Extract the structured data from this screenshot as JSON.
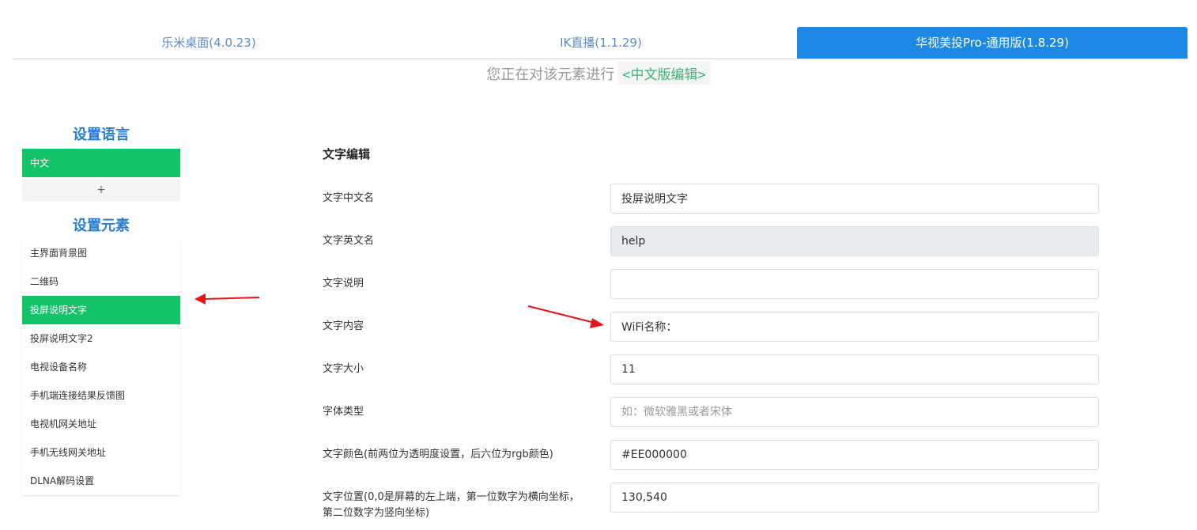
{
  "tabs": [
    {
      "label": "乐米桌面(4.0.23)",
      "active": false
    },
    {
      "label": "IK直播(1.1.29)",
      "active": false
    },
    {
      "label": "华视美投Pro-通用版(1.8.29)",
      "active": true
    }
  ],
  "editing": {
    "prefix": "您正在对该元素进行",
    "mode": "<中文版编辑>"
  },
  "sidebar": {
    "language_title": "设置语言",
    "languages": [
      {
        "label": "中文",
        "active": true
      }
    ],
    "add_label": "+",
    "element_title": "设置元素",
    "elements": [
      {
        "label": "主界面背景图",
        "active": false
      },
      {
        "label": "二维码",
        "active": false
      },
      {
        "label": "投屏说明文字",
        "active": true
      },
      {
        "label": "投屏说明文字2",
        "active": false
      },
      {
        "label": "电视设备名称",
        "active": false
      },
      {
        "label": "手机端连接结果反馈图",
        "active": false
      },
      {
        "label": "电视机网关地址",
        "active": false
      },
      {
        "label": "手机无线网关地址",
        "active": false
      },
      {
        "label": "DLNA解码设置",
        "active": false
      }
    ]
  },
  "form": {
    "title": "文字编辑",
    "fields": [
      {
        "label": "文字中文名",
        "value": "投屏说明文字",
        "placeholder": "",
        "disabled": false
      },
      {
        "label": "文字英文名",
        "value": "help",
        "placeholder": "",
        "disabled": true
      },
      {
        "label": "文字说明",
        "value": "",
        "placeholder": "",
        "disabled": false
      },
      {
        "label": "文字内容",
        "value": "WiFi名称：",
        "placeholder": "",
        "disabled": false
      },
      {
        "label": "文字大小",
        "value": "11",
        "placeholder": "",
        "disabled": false
      },
      {
        "label": "字体类型",
        "value": "",
        "placeholder": "如：微软雅黑或者宋体",
        "disabled": false
      },
      {
        "label": "文字颜色(前两位为透明度设置，后六位为rgb颜色)",
        "value": "#EE000000",
        "placeholder": "",
        "disabled": false
      },
      {
        "label": "文字位置(0,0是屏幕的左上端，第一位数字为横向坐标，第二位数字为竖向坐标)",
        "value": "130,540",
        "placeholder": "",
        "disabled": false
      }
    ]
  },
  "colors": {
    "accent_blue": "#1e88e5",
    "active_green": "#13c36a",
    "arrow_red": "#e8131b"
  }
}
